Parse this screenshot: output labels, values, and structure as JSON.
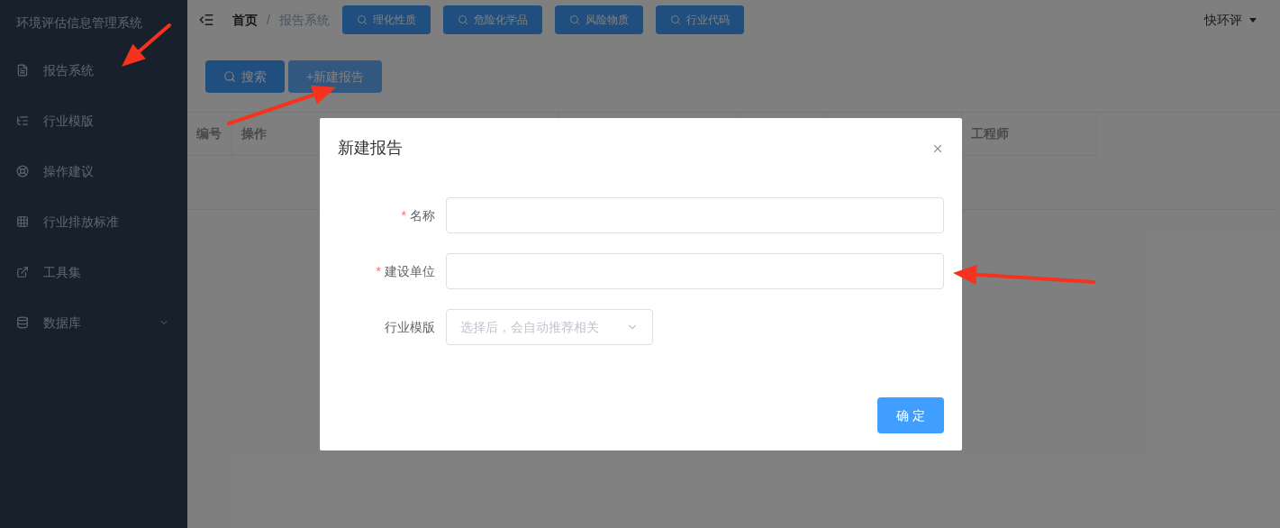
{
  "sidebar": {
    "title": "环境评估信息管理系统",
    "items": [
      {
        "label": "报告系统",
        "expandable": false
      },
      {
        "label": "行业模版",
        "expandable": false
      },
      {
        "label": "操作建议",
        "expandable": false
      },
      {
        "label": "行业排放标准",
        "expandable": false
      },
      {
        "label": "工具集",
        "expandable": false
      },
      {
        "label": "数据库",
        "expandable": true
      }
    ]
  },
  "breadcrumb": [
    {
      "label": "首页",
      "current": false
    },
    {
      "label": "报告系统",
      "current": true
    }
  ],
  "breadcrumb_separator": "/",
  "quick_buttons": [
    "理化性质",
    "危险化学品",
    "风险物质",
    "行业代码"
  ],
  "user_menu": {
    "label": "快环评"
  },
  "toolbar": [
    {
      "label": "搜索",
      "kind": "search",
      "hovered": false
    },
    {
      "label": "+新建报告",
      "kind": "plain",
      "hovered": true
    }
  ],
  "table": {
    "columns": [
      "编号",
      "操作",
      "工程师"
    ]
  },
  "dialog": {
    "title": "新建报告",
    "fields": [
      {
        "label": "名称",
        "required": true,
        "kind": "input"
      },
      {
        "label": "建设单位",
        "required": true,
        "kind": "input"
      },
      {
        "label": "行业模版",
        "required": false,
        "kind": "select",
        "placeholder": "选择后，会自动推荐相关"
      }
    ],
    "required_mark": "*",
    "confirm": "确 定"
  }
}
